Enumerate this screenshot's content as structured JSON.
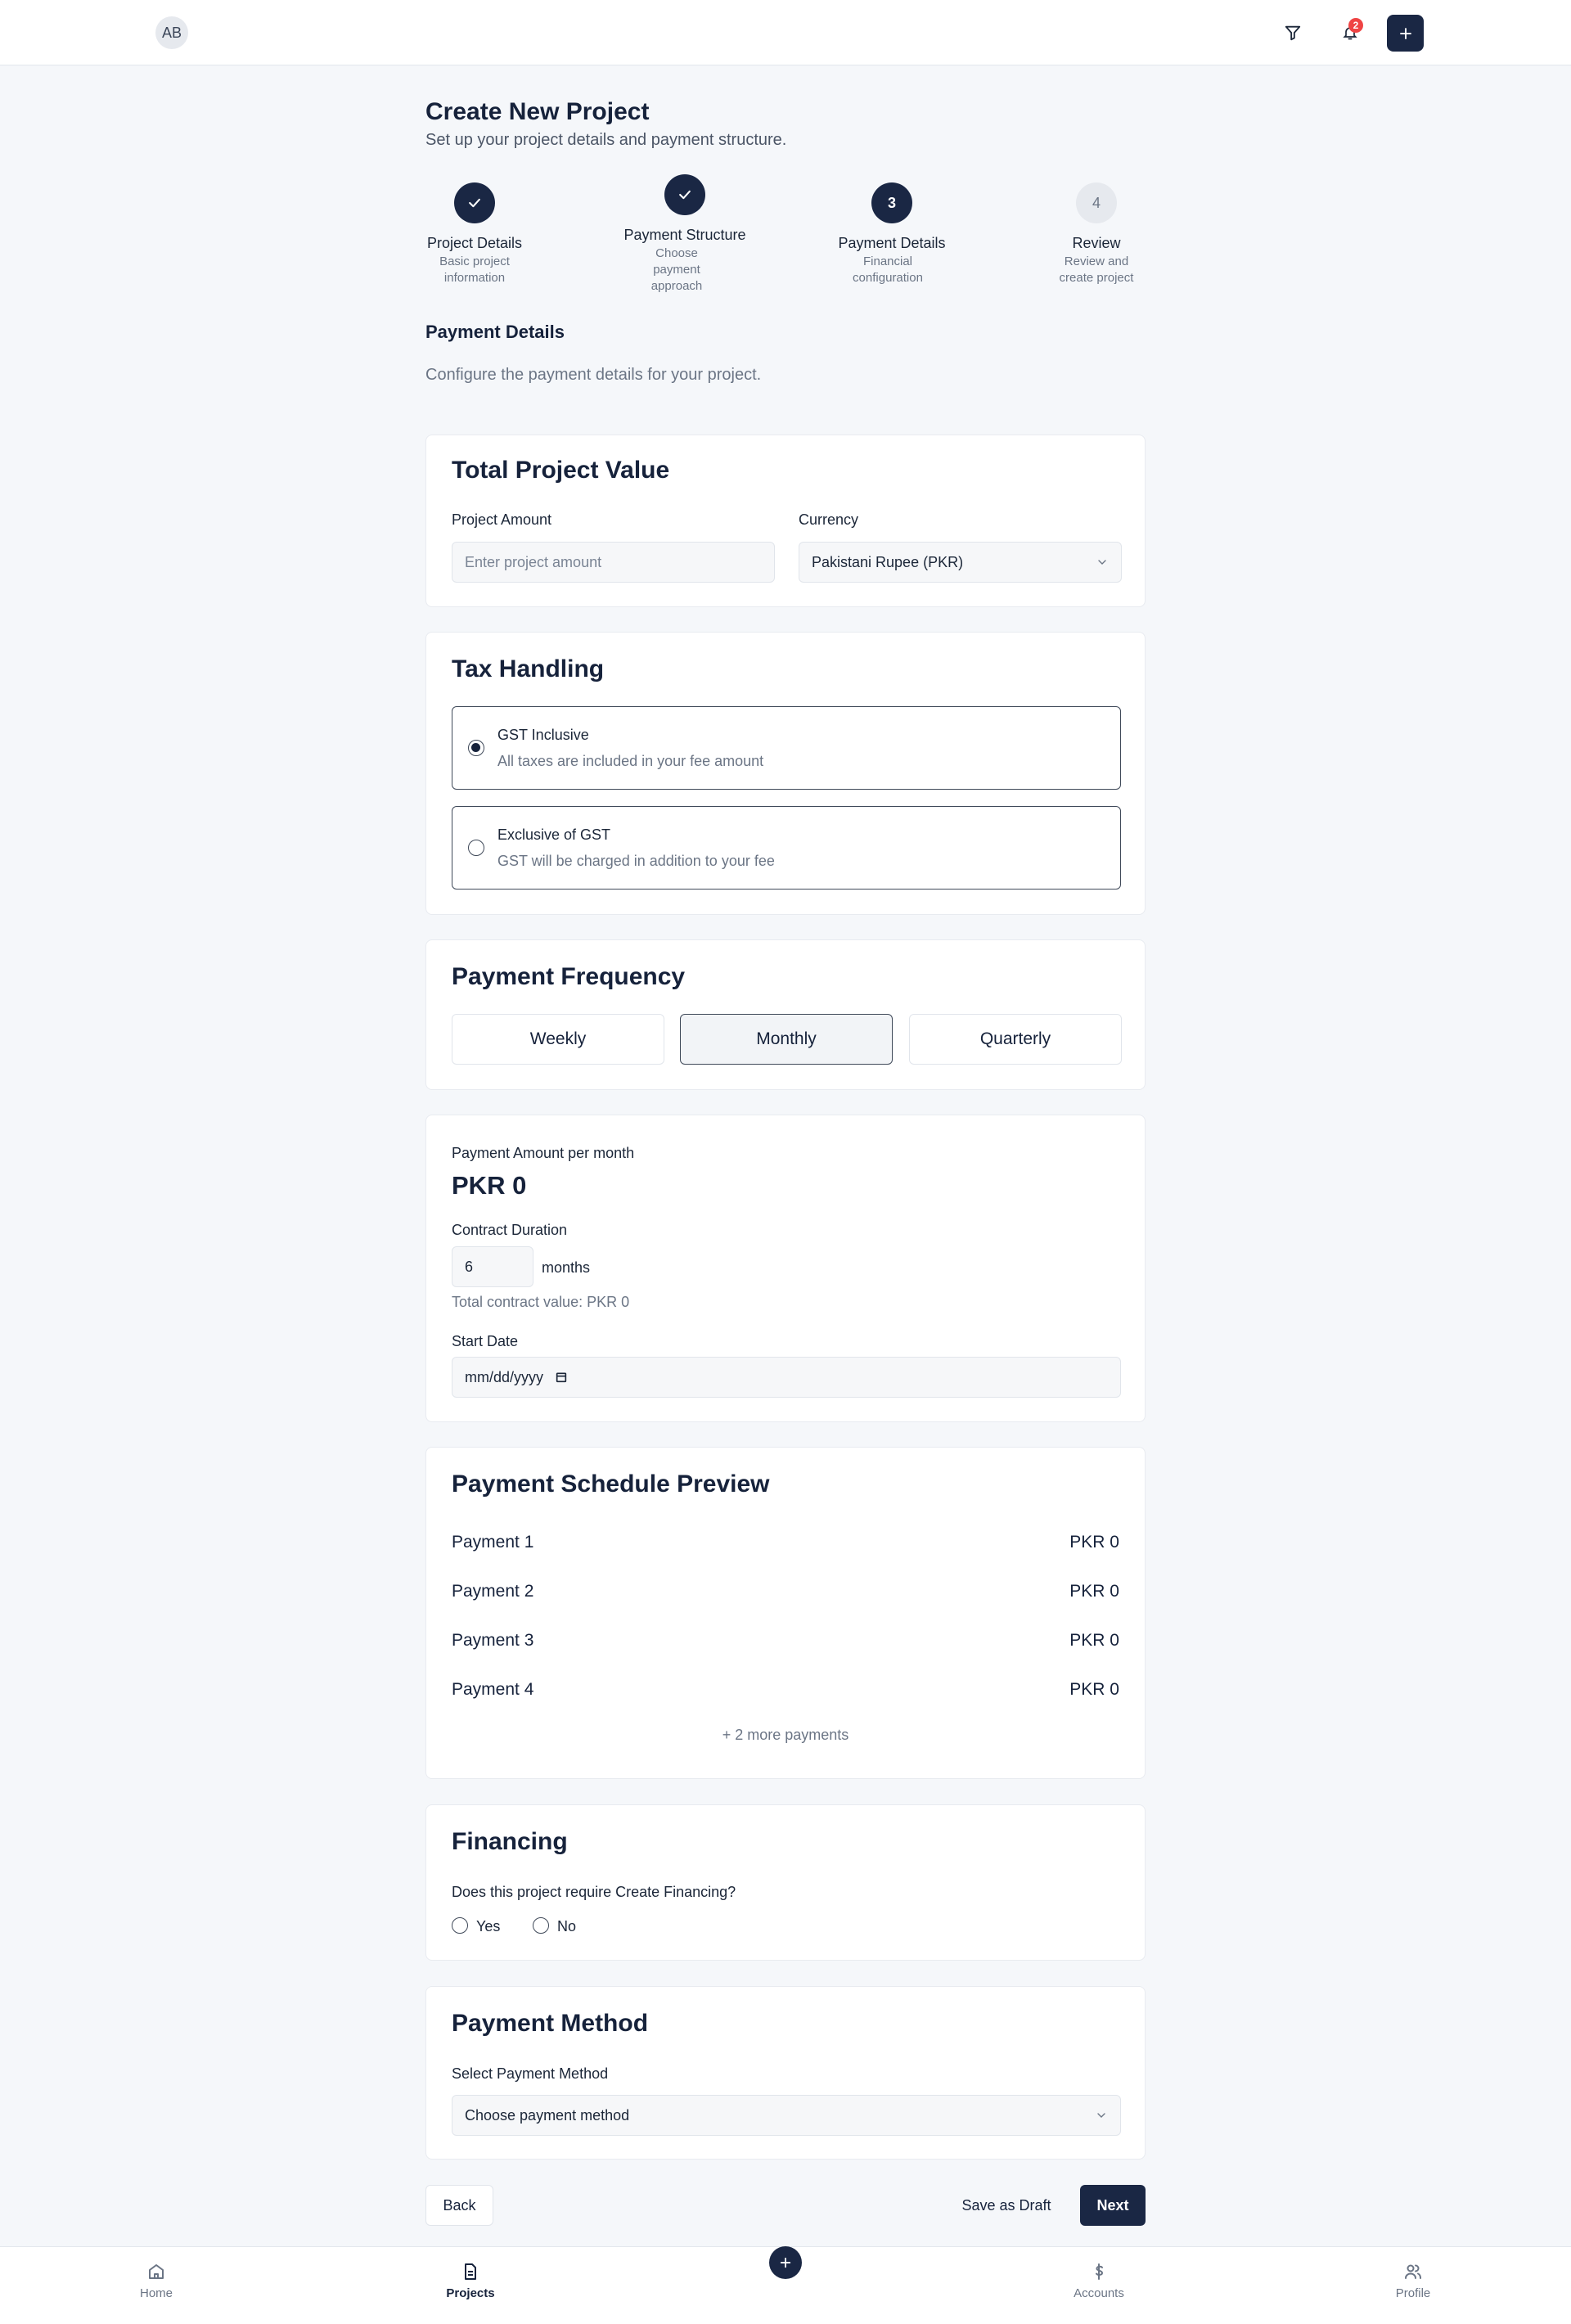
{
  "header": {
    "avatar_initials": "AB",
    "notification_count": "2"
  },
  "page": {
    "title": "Create New Project",
    "subtitle": "Set up your project details and payment structure."
  },
  "steps": [
    {
      "number": "",
      "title": "Project Details",
      "desc_lines": [
        "Basic project",
        "information"
      ],
      "state": "done"
    },
    {
      "number": "",
      "title": "Payment Structure",
      "desc_lines": [
        "Choose",
        "payment",
        "approach"
      ],
      "state": "done"
    },
    {
      "number": "3",
      "title": "Payment Details",
      "desc_lines": [
        "Financial",
        "configuration"
      ],
      "state": "current"
    },
    {
      "number": "4",
      "title": "Review",
      "desc_lines": [
        "Review and",
        "create project"
      ],
      "state": "pending"
    }
  ],
  "section": {
    "heading": "Payment Details",
    "description": "Configure the payment details for your project."
  },
  "total_value": {
    "title": "Total Project Value",
    "amount_label": "Project Amount",
    "amount_placeholder": "Enter project amount",
    "currency_label": "Currency",
    "currency_value": "Pakistani Rupee (PKR)"
  },
  "tax": {
    "title": "Tax Handling",
    "options": [
      {
        "label": "GST Inclusive",
        "desc": "All taxes are included in your fee amount",
        "selected": true
      },
      {
        "label": "Exclusive of GST",
        "desc": "GST will be charged in addition to your fee",
        "selected": false
      }
    ]
  },
  "frequency": {
    "title": "Payment Frequency",
    "options": [
      "Weekly",
      "Monthly",
      "Quarterly"
    ],
    "selected": "Monthly"
  },
  "amount": {
    "per_label": "Payment Amount per month",
    "value": "PKR 0",
    "duration_label": "Contract Duration",
    "duration_value": "6",
    "duration_unit": "months",
    "total_text": "Total contract value: PKR 0",
    "start_label": "Start Date",
    "start_placeholder": "mm/dd/yyyy"
  },
  "schedule": {
    "title": "Payment Schedule Preview",
    "rows": [
      {
        "label": "Payment 1",
        "amount": "PKR 0"
      },
      {
        "label": "Payment 2",
        "amount": "PKR 0"
      },
      {
        "label": "Payment 3",
        "amount": "PKR 0"
      },
      {
        "label": "Payment 4",
        "amount": "PKR 0"
      }
    ],
    "more": "+ 2 more payments"
  },
  "financing": {
    "title": "Financing",
    "question": "Does this project require Create Financing?",
    "yes": "Yes",
    "no": "No"
  },
  "method": {
    "title": "Payment Method",
    "label": "Select Payment Method",
    "placeholder": "Choose payment method"
  },
  "actions": {
    "back": "Back",
    "draft": "Save as Draft",
    "next": "Next"
  },
  "nav": {
    "home": "Home",
    "projects": "Projects",
    "accounts": "Accounts",
    "profile": "Profile"
  },
  "colors": {
    "primary": "#1a2744",
    "badge": "#ef4444",
    "background": "#f5f7fa"
  }
}
